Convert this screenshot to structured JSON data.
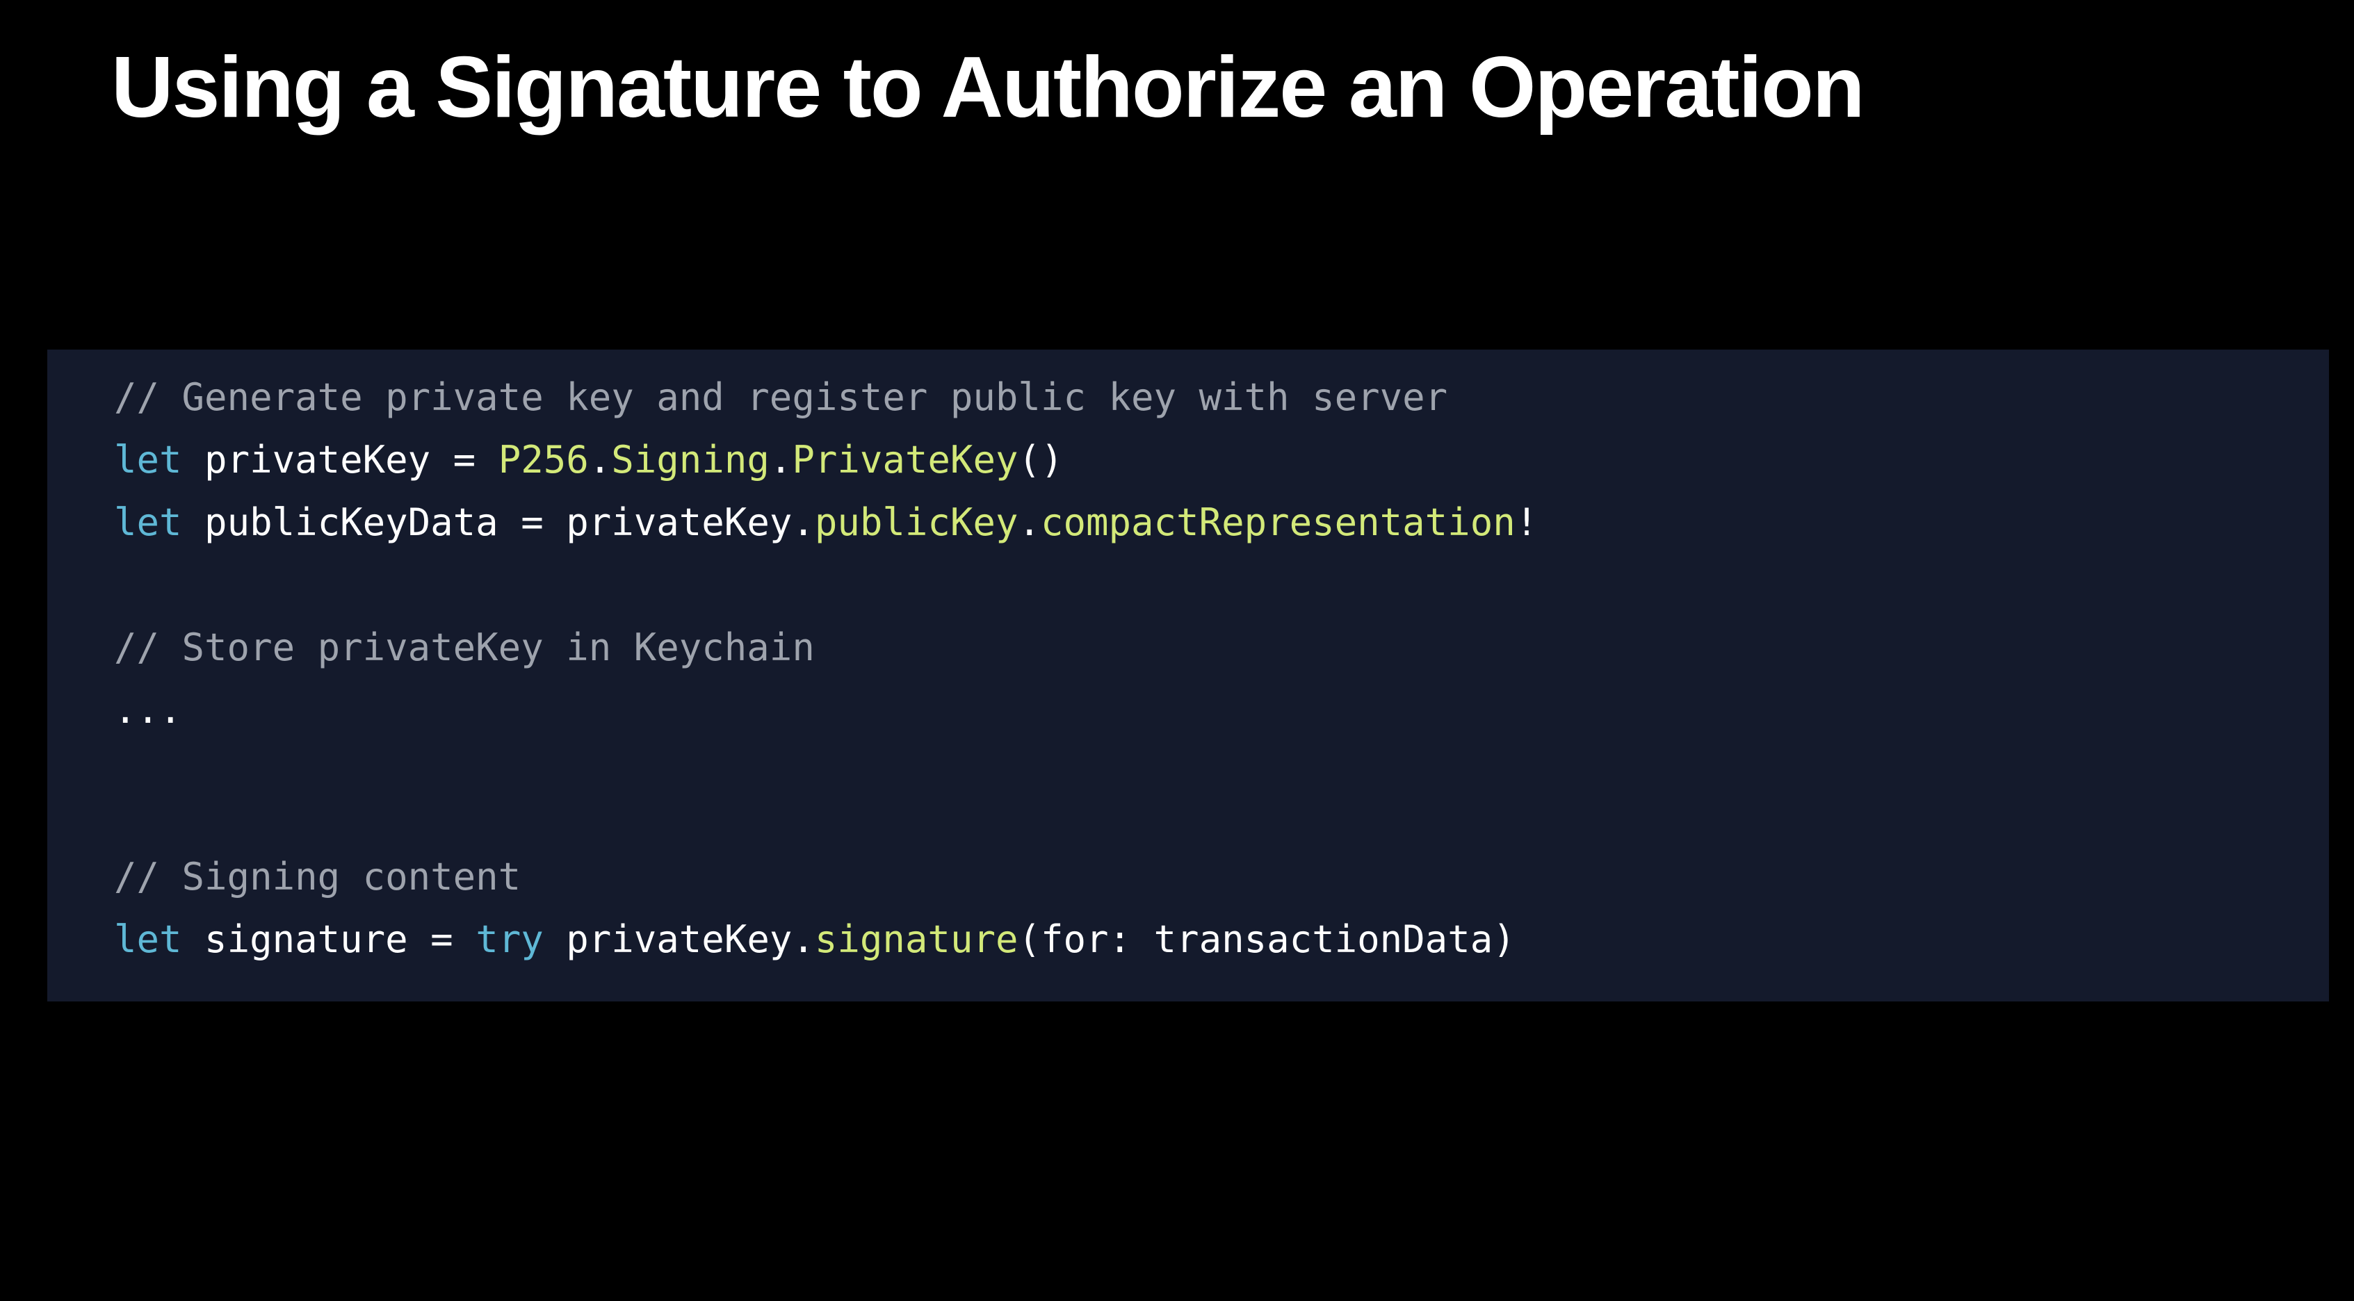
{
  "slide": {
    "title": "Using a Signature to Authorize an Operation"
  },
  "colors": {
    "background": "#000000",
    "code_background": "#141a2c",
    "comment": "#9ea3ad",
    "keyword": "#5fb8d6",
    "plain": "#ffffff",
    "type": "#d3e979",
    "member": "#d3e979"
  },
  "code": {
    "line1": {
      "comment": "// Generate private key and register public key with server"
    },
    "line2": {
      "kw": "let",
      "p1": " privateKey = ",
      "t1": "P256",
      "d1": ".",
      "t2": "Signing",
      "d2": ".",
      "t3": "PrivateKey",
      "end": "()"
    },
    "line3": {
      "kw": "let",
      "p1": " publicKeyData = privateKey.",
      "m1": "publicKey",
      "d1": ".",
      "m2": "compactRepresentation",
      "end": "!"
    },
    "line4": {
      "comment": "// Store privateKey in Keychain"
    },
    "line5": {
      "text": "..."
    },
    "line6": {
      "comment": "// Signing content"
    },
    "line7": {
      "kw": "let",
      "p1": " signature = ",
      "kw2": "try",
      "p2": " privateKey.",
      "m1": "signature",
      "end": "(for: transactionData)"
    }
  }
}
